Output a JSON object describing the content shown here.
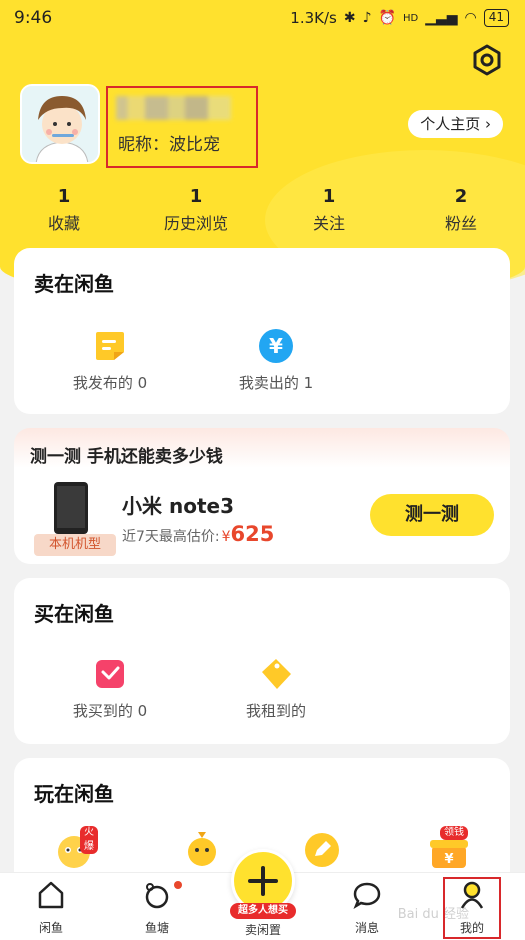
{
  "status_bar": {
    "time": "9:46",
    "network_speed": "1.3K/s",
    "battery": "41",
    "icons": [
      "bluetooth-icon",
      "mute-icon",
      "alarm-icon",
      "hd-icon",
      "signal-icon",
      "wifi-icon"
    ]
  },
  "header": {
    "settings_icon": "hexagon-settings-icon",
    "nickname_label": "昵称：波比宠",
    "homepage_button": "个人主页 ›"
  },
  "stats": [
    {
      "num": "1",
      "label": "收藏"
    },
    {
      "num": "1",
      "label": "历史浏览"
    },
    {
      "num": "1",
      "label": "关注"
    },
    {
      "num": "2",
      "label": "粉丝"
    }
  ],
  "sell_section": {
    "title": "卖在闲鱼",
    "items": [
      {
        "label": "我发布的 0",
        "icon": "published-icon"
      },
      {
        "label": "我卖出的 1",
        "icon": "sold-yen-icon"
      }
    ]
  },
  "price_test": {
    "title": "测一测 手机还能卖多少钱",
    "model_tag": "本机机型",
    "phone_name": "小米 note3",
    "price_label": "近7天最高估价:",
    "currency": "¥",
    "price": "625",
    "button": "测一测"
  },
  "buy_section": {
    "title": "买在闲鱼",
    "items": [
      {
        "label": "我买到的 0",
        "icon": "bought-bag-icon"
      },
      {
        "label": "我租到的",
        "icon": "rented-tag-icon"
      }
    ]
  },
  "play_section": {
    "title": "玩在闲鱼",
    "hot_badge": "火爆",
    "money_badge": "领钱"
  },
  "bottom_nav": {
    "items": [
      {
        "label": "闲鱼",
        "icon": "home-icon"
      },
      {
        "label": "鱼塘",
        "icon": "pond-icon"
      },
      {
        "label": "卖闲置",
        "icon": "plus-icon"
      },
      {
        "label": "消息",
        "icon": "message-icon"
      },
      {
        "label": "我的",
        "icon": "user-icon"
      }
    ],
    "sell_badge": "超多人想买",
    "watermark": "Bai du 经验"
  },
  "colors": {
    "brand_yellow": "#ffe12e",
    "price_red": "#e8472c",
    "highlight_red": "#d8282b"
  }
}
